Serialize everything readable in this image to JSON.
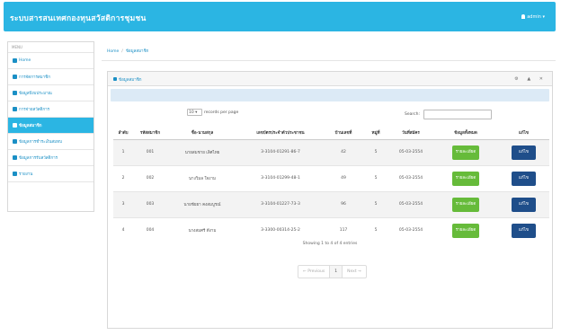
{
  "navbar": {
    "title": "ระบบสารสนเทศกองทุนสวัสดิการชุมชน",
    "user": "admin"
  },
  "sidebar": {
    "header": "MENU",
    "items": [
      {
        "label": "Home",
        "icon": "home-icon"
      },
      {
        "label": "การจัดการสมาชิก",
        "icon": "user-icon"
      },
      {
        "label": "ข้อมูลปีงบประมาณ",
        "icon": "list-icon"
      },
      {
        "label": "การจ่ายสวัสดิการ",
        "icon": "edit-icon"
      },
      {
        "label": "ข้อมูลสมาชิก",
        "icon": "list-icon",
        "active": true
      },
      {
        "label": "ข้อมูลการชำระเงินสมทบ",
        "icon": "list-icon"
      },
      {
        "label": "ข้อมูลการรับสวัสดิการ",
        "icon": "list-icon"
      },
      {
        "label": "รายงาน",
        "icon": "report-icon"
      }
    ]
  },
  "breadcrumb": {
    "home": "Home",
    "current": "ข้อมูลสมาชิก"
  },
  "panel": {
    "title": "ข้อมูลสมาชิก",
    "controls": "⚙ ▲ ✕",
    "length_value": "10",
    "length_label": "records per page",
    "search_label": "Search:"
  },
  "table": {
    "columns": [
      "ลำดับ",
      "รหัสสมาชิก",
      "ชื่อ-นามสกุล",
      "เลขบัตรประจำตัวประชาชน",
      "บ้านเลขที่",
      "หมู่ที่",
      "วันที่สมัคร",
      "ข้อมูลทั้งหมด",
      "แก้ไข"
    ],
    "rows": [
      [
        "1",
        "001",
        "นายสมชาย เลิศไทย",
        "3-3104-01291-86-7",
        "42",
        "5",
        "05-03-2554",
        "รายละเอียด",
        "แก้ไข"
      ],
      [
        "2",
        "002",
        "นางวิมล ใจงาม",
        "3-3104-01299-48-1",
        "49",
        "5",
        "05-03-2554",
        "รายละเอียด",
        "แก้ไข"
      ],
      [
        "3",
        "003",
        "นายชัยยา คงสมบูรณ์",
        "3-3104-01227-73-3",
        "96",
        "5",
        "05-03-2554",
        "รายละเอียด",
        "แก้ไข"
      ],
      [
        "4",
        "004",
        "นางสมศรี ดีงาม",
        "3-3300-00314-25-2",
        "117",
        "5",
        "05-03-2554",
        "รายละเอียด",
        "แก้ไข"
      ]
    ]
  },
  "footer": {
    "info": "Showing 1 to 4 of 4 entries",
    "prev": "← Previous",
    "page": "1",
    "next": "Next →"
  },
  "colors": {
    "primary": "#2bb5e3",
    "detail_button": "#66bb3a",
    "edit_button": "#1f4e8a"
  }
}
